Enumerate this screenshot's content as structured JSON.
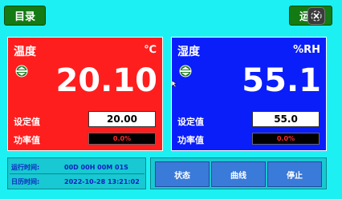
{
  "header": {
    "menu_label": "目录",
    "run_label": "运"
  },
  "temperature": {
    "title": "温度",
    "unit": "℃",
    "value": "20.10",
    "setpoint_label": "设定值",
    "setpoint_value": "20.00",
    "power_label": "功率值",
    "power_value": "0.0%",
    "icon": "status-indicator-icon",
    "color": "#ff1e1e"
  },
  "humidity": {
    "title": "湿度",
    "unit": "%RH",
    "value": "55.1",
    "setpoint_label": "设定值",
    "setpoint_value": "55.0",
    "power_label": "功率值",
    "power_value": "0.0%",
    "icon": "status-indicator-icon",
    "color": "#0a1efa"
  },
  "info": {
    "run_time_label": "运行时间:",
    "run_time_value": "00D 00H 00M 01S",
    "calendar_label": "日历时间:",
    "calendar_value": "2022-10-28 13:21:02"
  },
  "actions": {
    "status_label": "状态",
    "curve_label": "曲线",
    "stop_label": "停止"
  },
  "colors": {
    "background": "#1df0f2",
    "button_green": "#147a14",
    "action_blue": "#3a7ad8",
    "info_text": "#1020c0"
  }
}
